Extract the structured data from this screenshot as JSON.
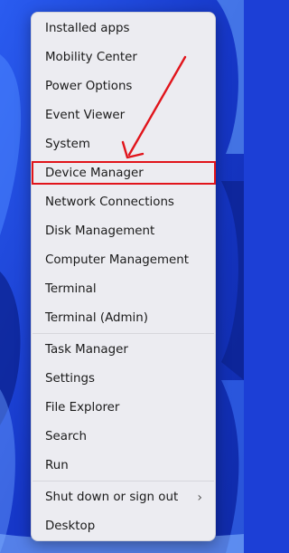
{
  "menu": {
    "items": [
      {
        "label": "Installed apps"
      },
      {
        "label": "Mobility Center"
      },
      {
        "label": "Power Options"
      },
      {
        "label": "Event Viewer"
      },
      {
        "label": "System"
      },
      {
        "label": "Device Manager"
      },
      {
        "label": "Network Connections"
      },
      {
        "label": "Disk Management"
      },
      {
        "label": "Computer Management"
      },
      {
        "label": "Terminal"
      },
      {
        "label": "Terminal (Admin)"
      },
      {
        "label": "Task Manager"
      },
      {
        "label": "Settings"
      },
      {
        "label": "File Explorer"
      },
      {
        "label": "Search"
      },
      {
        "label": "Run"
      },
      {
        "label": "Shut down or sign out",
        "submenu_icon": "chevron-right-icon"
      },
      {
        "label": "Desktop"
      }
    ]
  },
  "annotation": {
    "highlighted_item": "Device Manager",
    "color": "#e1141b"
  },
  "colors": {
    "wallpaper_blue": "#1c3fd6",
    "menu_background": "#ececf1"
  }
}
